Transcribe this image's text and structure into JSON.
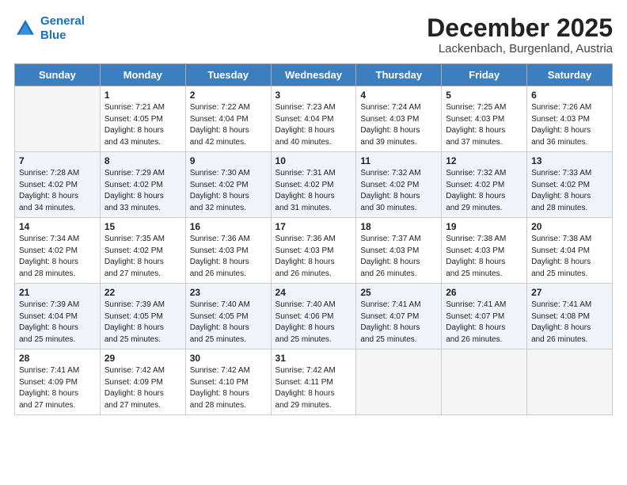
{
  "header": {
    "logo_line1": "General",
    "logo_line2": "Blue",
    "month": "December 2025",
    "location": "Lackenbach, Burgenland, Austria"
  },
  "days_of_week": [
    "Sunday",
    "Monday",
    "Tuesday",
    "Wednesday",
    "Thursday",
    "Friday",
    "Saturday"
  ],
  "weeks": [
    [
      {
        "day": "",
        "content": ""
      },
      {
        "day": "1",
        "content": "Sunrise: 7:21 AM\nSunset: 4:05 PM\nDaylight: 8 hours\nand 43 minutes."
      },
      {
        "day": "2",
        "content": "Sunrise: 7:22 AM\nSunset: 4:04 PM\nDaylight: 8 hours\nand 42 minutes."
      },
      {
        "day": "3",
        "content": "Sunrise: 7:23 AM\nSunset: 4:04 PM\nDaylight: 8 hours\nand 40 minutes."
      },
      {
        "day": "4",
        "content": "Sunrise: 7:24 AM\nSunset: 4:03 PM\nDaylight: 8 hours\nand 39 minutes."
      },
      {
        "day": "5",
        "content": "Sunrise: 7:25 AM\nSunset: 4:03 PM\nDaylight: 8 hours\nand 37 minutes."
      },
      {
        "day": "6",
        "content": "Sunrise: 7:26 AM\nSunset: 4:03 PM\nDaylight: 8 hours\nand 36 minutes."
      }
    ],
    [
      {
        "day": "7",
        "content": "Sunrise: 7:28 AM\nSunset: 4:02 PM\nDaylight: 8 hours\nand 34 minutes."
      },
      {
        "day": "8",
        "content": "Sunrise: 7:29 AM\nSunset: 4:02 PM\nDaylight: 8 hours\nand 33 minutes."
      },
      {
        "day": "9",
        "content": "Sunrise: 7:30 AM\nSunset: 4:02 PM\nDaylight: 8 hours\nand 32 minutes."
      },
      {
        "day": "10",
        "content": "Sunrise: 7:31 AM\nSunset: 4:02 PM\nDaylight: 8 hours\nand 31 minutes."
      },
      {
        "day": "11",
        "content": "Sunrise: 7:32 AM\nSunset: 4:02 PM\nDaylight: 8 hours\nand 30 minutes."
      },
      {
        "day": "12",
        "content": "Sunrise: 7:32 AM\nSunset: 4:02 PM\nDaylight: 8 hours\nand 29 minutes."
      },
      {
        "day": "13",
        "content": "Sunrise: 7:33 AM\nSunset: 4:02 PM\nDaylight: 8 hours\nand 28 minutes."
      }
    ],
    [
      {
        "day": "14",
        "content": "Sunrise: 7:34 AM\nSunset: 4:02 PM\nDaylight: 8 hours\nand 28 minutes."
      },
      {
        "day": "15",
        "content": "Sunrise: 7:35 AM\nSunset: 4:02 PM\nDaylight: 8 hours\nand 27 minutes."
      },
      {
        "day": "16",
        "content": "Sunrise: 7:36 AM\nSunset: 4:03 PM\nDaylight: 8 hours\nand 26 minutes."
      },
      {
        "day": "17",
        "content": "Sunrise: 7:36 AM\nSunset: 4:03 PM\nDaylight: 8 hours\nand 26 minutes."
      },
      {
        "day": "18",
        "content": "Sunrise: 7:37 AM\nSunset: 4:03 PM\nDaylight: 8 hours\nand 26 minutes."
      },
      {
        "day": "19",
        "content": "Sunrise: 7:38 AM\nSunset: 4:03 PM\nDaylight: 8 hours\nand 25 minutes."
      },
      {
        "day": "20",
        "content": "Sunrise: 7:38 AM\nSunset: 4:04 PM\nDaylight: 8 hours\nand 25 minutes."
      }
    ],
    [
      {
        "day": "21",
        "content": "Sunrise: 7:39 AM\nSunset: 4:04 PM\nDaylight: 8 hours\nand 25 minutes."
      },
      {
        "day": "22",
        "content": "Sunrise: 7:39 AM\nSunset: 4:05 PM\nDaylight: 8 hours\nand 25 minutes."
      },
      {
        "day": "23",
        "content": "Sunrise: 7:40 AM\nSunset: 4:05 PM\nDaylight: 8 hours\nand 25 minutes."
      },
      {
        "day": "24",
        "content": "Sunrise: 7:40 AM\nSunset: 4:06 PM\nDaylight: 8 hours\nand 25 minutes."
      },
      {
        "day": "25",
        "content": "Sunrise: 7:41 AM\nSunset: 4:07 PM\nDaylight: 8 hours\nand 25 minutes."
      },
      {
        "day": "26",
        "content": "Sunrise: 7:41 AM\nSunset: 4:07 PM\nDaylight: 8 hours\nand 26 minutes."
      },
      {
        "day": "27",
        "content": "Sunrise: 7:41 AM\nSunset: 4:08 PM\nDaylight: 8 hours\nand 26 minutes."
      }
    ],
    [
      {
        "day": "28",
        "content": "Sunrise: 7:41 AM\nSunset: 4:09 PM\nDaylight: 8 hours\nand 27 minutes."
      },
      {
        "day": "29",
        "content": "Sunrise: 7:42 AM\nSunset: 4:09 PM\nDaylight: 8 hours\nand 27 minutes."
      },
      {
        "day": "30",
        "content": "Sunrise: 7:42 AM\nSunset: 4:10 PM\nDaylight: 8 hours\nand 28 minutes."
      },
      {
        "day": "31",
        "content": "Sunrise: 7:42 AM\nSunset: 4:11 PM\nDaylight: 8 hours\nand 29 minutes."
      },
      {
        "day": "",
        "content": ""
      },
      {
        "day": "",
        "content": ""
      },
      {
        "day": "",
        "content": ""
      }
    ]
  ]
}
